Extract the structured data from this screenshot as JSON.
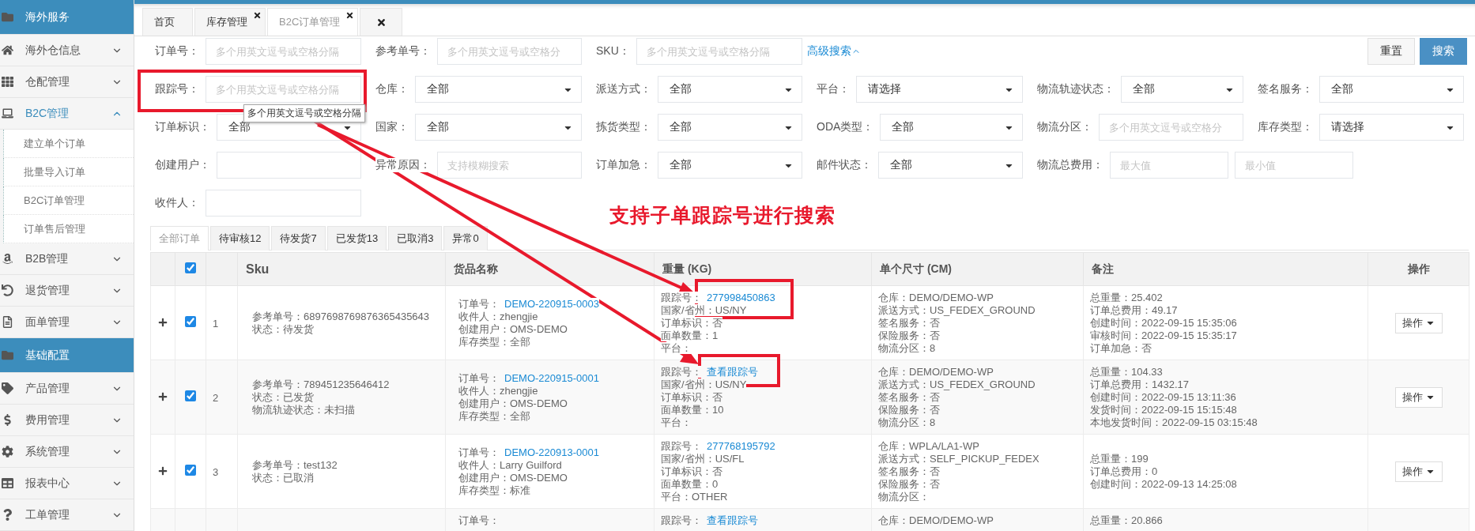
{
  "sidebar": {
    "items": [
      {
        "kind": "section",
        "label": "海外服务"
      },
      {
        "kind": "menu",
        "label": "海外仓信息",
        "expanded": false
      },
      {
        "kind": "menu",
        "label": "仓配管理",
        "expanded": false
      },
      {
        "kind": "menu",
        "label": "B2C管理",
        "expanded": true,
        "children": [
          {
            "label": "建立单个订单"
          },
          {
            "label": "批量导入订单"
          },
          {
            "label": "B2C订单管理"
          },
          {
            "label": "订单售后管理"
          }
        ]
      },
      {
        "kind": "menu",
        "label": "B2B管理",
        "expanded": false
      },
      {
        "kind": "menu",
        "label": "退货管理",
        "expanded": false
      },
      {
        "kind": "menu",
        "label": "面单管理",
        "expanded": false
      },
      {
        "kind": "section",
        "label": "基础配置"
      },
      {
        "kind": "menu",
        "label": "产品管理",
        "expanded": false
      },
      {
        "kind": "menu",
        "label": "费用管理",
        "expanded": false
      },
      {
        "kind": "menu",
        "label": "系统管理",
        "expanded": false
      },
      {
        "kind": "menu",
        "label": "报表中心",
        "expanded": false
      },
      {
        "kind": "menu",
        "label": "工单管理",
        "expanded": false
      }
    ]
  },
  "tabs": [
    {
      "kind": "page",
      "label": "首页",
      "selected": false,
      "closable": false
    },
    {
      "kind": "page",
      "label": "库存管理",
      "selected": false,
      "closable": true
    },
    {
      "kind": "page",
      "label": "B2C订单管理",
      "selected": true,
      "closable": true
    },
    {
      "kind": "close-all"
    }
  ],
  "filters": {
    "rows": [
      [
        {
          "kind": "text",
          "label": "订单号：",
          "placeholder": "多个用英文逗号或空格分隔"
        },
        {
          "kind": "text",
          "label": "参考单号：",
          "placeholder": "多个用英文逗号或空格分"
        },
        {
          "kind": "text",
          "label": "SKU：",
          "placeholder": "多个用英文逗号或空格分隔"
        },
        {
          "kind": "link",
          "label": "高级搜索"
        }
      ],
      [
        {
          "kind": "text",
          "label": "跟踪号：",
          "placeholder": "多个用英文逗号或空格分隔",
          "tooltip": "多个用英文逗号或空格分隔"
        },
        {
          "kind": "select",
          "label": "仓库：",
          "value": "全部"
        },
        {
          "kind": "select",
          "label": "派送方式：",
          "value": "全部"
        },
        {
          "kind": "select",
          "label": "平台：",
          "value": "请选择"
        },
        {
          "kind": "select",
          "label": "物流轨迹状态：",
          "value": "全部"
        },
        {
          "kind": "select",
          "label": "签名服务：",
          "value": "全部"
        }
      ],
      [
        {
          "kind": "select",
          "label": "订单标识：",
          "value": "全部"
        },
        {
          "kind": "select",
          "label": "国家：",
          "value": "全部"
        },
        {
          "kind": "select",
          "label": "拣货类型：",
          "value": "全部"
        },
        {
          "kind": "select",
          "label": "ODA类型：",
          "value": "全部"
        },
        {
          "kind": "text",
          "label": "物流分区：",
          "placeholder": "多个用英文逗号或空格分"
        },
        {
          "kind": "select",
          "label": "库存类型：",
          "value": "请选择"
        }
      ],
      [
        {
          "kind": "text",
          "label": "创建用户："
        },
        {
          "kind": "text",
          "label": "异常原因：",
          "placeholder": "支持模糊搜索"
        },
        {
          "kind": "select",
          "label": "订单加急：",
          "value": "全部"
        },
        {
          "kind": "select",
          "label": "邮件状态：",
          "value": "全部"
        },
        {
          "kind": "range",
          "label": "物流总费用：",
          "fields": [
            {
              "placeholder": "最大值"
            },
            {
              "placeholder": "最小值"
            }
          ]
        }
      ],
      [
        {
          "kind": "text",
          "label": "收件人："
        }
      ]
    ],
    "buttons": [
      {
        "kind": "default",
        "label": "重置"
      },
      {
        "kind": "primary",
        "label": "搜索"
      }
    ]
  },
  "annotation": {
    "text": "支持子单跟踪号进行搜索"
  },
  "order_tabs": [
    {
      "label": "全部订单",
      "selected": true
    },
    {
      "label": "待审核12",
      "selected": false
    },
    {
      "label": "待发货7",
      "selected": false
    },
    {
      "label": "已发货13",
      "selected": false
    },
    {
      "label": "已取消3",
      "selected": false
    },
    {
      "label": "异常0",
      "selected": false
    }
  ],
  "table": {
    "select_all": {
      "checked": true
    },
    "columns": [
      "Sku",
      "货品名称",
      "重量 (KG)",
      "单个尺寸 (CM)",
      "备注",
      "操作"
    ],
    "rows": [
      {
        "index": "1",
        "checked": true,
        "action": "操作",
        "sku": [
          {
            "label": "参考单号：",
            "value": "6897698769876365435643"
          },
          {
            "label": "状态：",
            "value": "待发货"
          }
        ],
        "goods": [
          {
            "label": "订单号：",
            "value": "DEMO-220915-0003",
            "link": true
          },
          {
            "label": "收件人：",
            "value": "zhengjie"
          },
          {
            "label": "创建用户：",
            "value": "OMS-DEMO"
          },
          {
            "label": "库存类型：",
            "value": "全部"
          }
        ],
        "weight": [
          {
            "label": "跟踪号：",
            "value": "277998450863",
            "link": true
          },
          {
            "label": "国家/省州：",
            "value": "US/NY"
          },
          {
            "label": "订单标识：",
            "value": "否"
          },
          {
            "label": "面单数量：",
            "value": "1"
          },
          {
            "label": "平台："
          }
        ],
        "size": [
          {
            "label": "仓库：",
            "value": "DEMO/DEMO-WP"
          },
          {
            "label": "派送方式：",
            "value": "US_FEDEX_GROUND"
          },
          {
            "label": "签名服务：",
            "value": "否"
          },
          {
            "label": "保险服务：",
            "value": "否"
          },
          {
            "label": "物流分区：",
            "value": "8"
          }
        ],
        "remarks": [
          {
            "label": "总重量：",
            "value": "25.402"
          },
          {
            "label": "订单总费用：",
            "value": "49.17"
          },
          {
            "label": "创建时间：",
            "value": "2022-09-15 15:35:06"
          },
          {
            "label": "审核时间：",
            "value": "2022-09-15 15:35:17"
          },
          {
            "label": "订单加急：",
            "value": "否"
          }
        ]
      },
      {
        "index": "2",
        "checked": true,
        "action": "操作",
        "sku": [
          {
            "label": "参考单号：",
            "value": "789451235646412"
          },
          {
            "label": "状态：",
            "value": "已发货"
          },
          {
            "label": "物流轨迹状态：",
            "value": "未扫描"
          }
        ],
        "goods": [
          {
            "label": "订单号：",
            "value": "DEMO-220915-0001",
            "link": true
          },
          {
            "label": "收件人：",
            "value": "zhengjie"
          },
          {
            "label": "创建用户：",
            "value": "OMS-DEMO"
          },
          {
            "label": "库存类型：",
            "value": "全部"
          }
        ],
        "weight": [
          {
            "label": "跟踪号：",
            "value": "查看跟踪号",
            "link": true
          },
          {
            "label": "国家/省州：",
            "value": "US/NY"
          },
          {
            "label": "订单标识：",
            "value": "否"
          },
          {
            "label": "面单数量：",
            "value": "10"
          },
          {
            "label": "平台："
          }
        ],
        "size": [
          {
            "label": "仓库：",
            "value": "DEMO/DEMO-WP"
          },
          {
            "label": "派送方式：",
            "value": "US_FEDEX_GROUND"
          },
          {
            "label": "签名服务：",
            "value": "否"
          },
          {
            "label": "保险服务：",
            "value": "否"
          },
          {
            "label": "物流分区：",
            "value": "8"
          }
        ],
        "remarks": [
          {
            "label": "总重量：",
            "value": "104.33"
          },
          {
            "label": "订单总费用：",
            "value": "1432.17"
          },
          {
            "label": "创建时间：",
            "value": "2022-09-15 13:11:36"
          },
          {
            "label": "发货时间：",
            "value": "2022-09-15 15:15:48"
          },
          {
            "label": "本地发货时间：",
            "value": "2022-09-15 03:15:48"
          }
        ]
      },
      {
        "index": "3",
        "checked": true,
        "action": "操作",
        "sku": [
          {
            "label": "参考单号：",
            "value": "test132"
          },
          {
            "label": "状态：",
            "value": "已取消"
          }
        ],
        "goods": [
          {
            "label": "订单号：",
            "value": "DEMO-220913-0001",
            "link": true
          },
          {
            "label": "收件人：",
            "value": "Larry Guilford"
          },
          {
            "label": "创建用户：",
            "value": "OMS-DEMO"
          },
          {
            "label": "库存类型：",
            "value": "标准"
          }
        ],
        "weight": [
          {
            "label": "跟踪号：",
            "value": "277768195792",
            "link": true
          },
          {
            "label": "国家/省州：",
            "value": "US/FL"
          },
          {
            "label": "订单标识：",
            "value": "否"
          },
          {
            "label": "面单数量：",
            "value": "0"
          },
          {
            "label": "平台：",
            "value": "OTHER"
          }
        ],
        "size": [
          {
            "label": "仓库：",
            "value": "WPLA/LA1-WP"
          },
          {
            "label": "派送方式：",
            "value": "SELF_PICKUP_FEDEX"
          },
          {
            "label": "签名服务：",
            "value": "否"
          },
          {
            "label": "保险服务：",
            "value": "否"
          },
          {
            "label": "物流分区："
          }
        ],
        "remarks": [
          {
            "label": "总重量：",
            "value": "199"
          },
          {
            "label": "订单总费用：",
            "value": "0"
          },
          {
            "label": "创建时间：",
            "value": "2022-09-13 14:25:08"
          }
        ]
      },
      {
        "goods": [
          {
            "label": "订单号："
          }
        ],
        "weight": [
          {
            "label": "跟踪号：",
            "value": "查看跟踪号",
            "link": true
          }
        ],
        "size": [
          {
            "label": "仓库：",
            "value": "DEMO/DEMO-WP"
          }
        ],
        "remarks": [
          {
            "label": "总重量：",
            "value": "20.866"
          }
        ]
      }
    ]
  }
}
